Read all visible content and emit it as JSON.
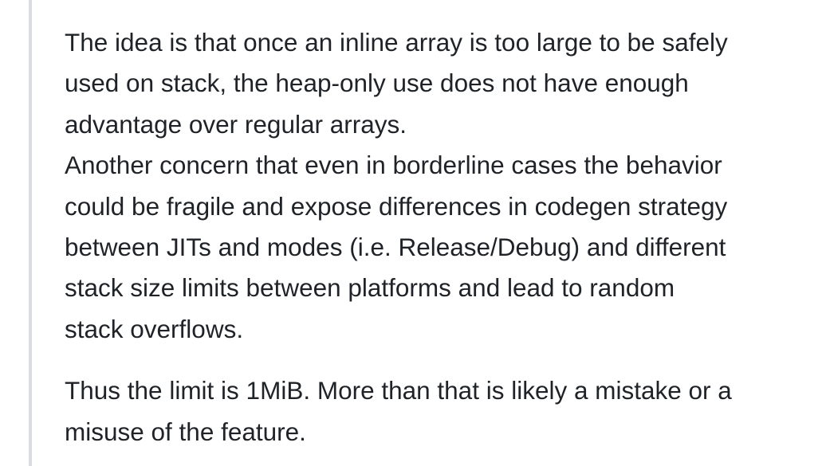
{
  "comment": {
    "paragraph1": [
      "The idea is that once an inline array is too large to be safely",
      "used on stack, the heap-only use does not have enough",
      "advantage over regular arrays.",
      "Another concern that even in borderline cases the behavior",
      "could be fragile and expose differences in codegen strategy",
      "between JITs and modes (i.e. Release/Debug) and different",
      "stack size limits between platforms and lead to random",
      "stack overflows."
    ],
    "paragraph2": [
      "Thus the limit is 1MiB. More than that is likely a mistake or a",
      "misuse of the feature."
    ]
  }
}
